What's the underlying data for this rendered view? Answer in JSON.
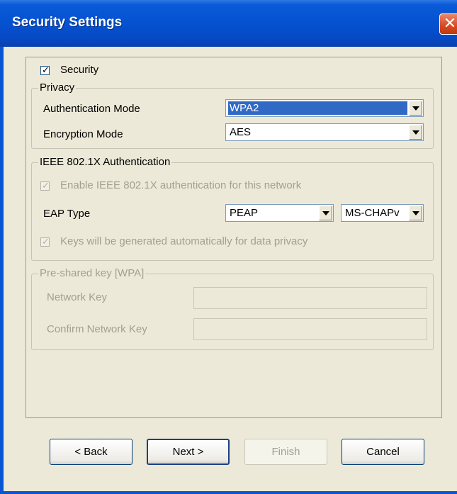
{
  "window": {
    "title": "Security Settings",
    "close_symbol": "✕"
  },
  "security": {
    "label": "Security",
    "checked": true
  },
  "privacy": {
    "legend": "Privacy",
    "authentication_mode": {
      "label": "Authentication Mode",
      "value": "WPA2"
    },
    "encryption_mode": {
      "label": "Encryption Mode",
      "value": "AES"
    }
  },
  "ieee8021x": {
    "legend": "IEEE 802.1X Authentication",
    "enable": {
      "label": "Enable IEEE 802.1X authentication for this network",
      "checked": true,
      "enabled": false
    },
    "eap_type": {
      "label": "EAP Type",
      "value": "PEAP",
      "inner_value": "MS-CHAPv"
    },
    "keys_auto": {
      "label": "Keys will be generated automatically for data privacy",
      "checked": true,
      "enabled": false
    }
  },
  "psk": {
    "legend": "Pre-shared key [WPA]",
    "network_key": {
      "label": "Network Key",
      "value": ""
    },
    "confirm_network_key": {
      "label": "Confirm Network Key",
      "value": ""
    }
  },
  "buttons": {
    "back": "< Back",
    "next": "Next >",
    "finish": "Finish",
    "cancel": "Cancel"
  },
  "icons": {
    "close": "close-icon",
    "checkmark": "checkmark-icon",
    "dropdown": "chevron-down-icon"
  }
}
